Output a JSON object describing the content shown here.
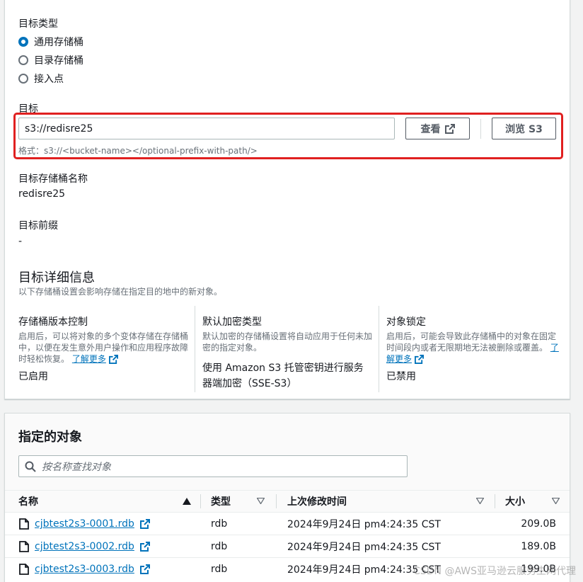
{
  "destination_type": {
    "heading": "目标类型",
    "options": [
      {
        "label": "通用存储桶",
        "selected": true
      },
      {
        "label": "目录存储桶",
        "selected": false
      },
      {
        "label": "接入点",
        "selected": false
      }
    ]
  },
  "destination": {
    "heading": "目标",
    "value": "s3://redisre25",
    "view_button": "查看",
    "browse_button": "浏览 S3",
    "format_hint": "格式：s3://<bucket-name></optional-prefix-with-path/>"
  },
  "bucket_name": {
    "label": "目标存储桶名称",
    "value": "redisre25"
  },
  "prefix": {
    "label": "目标前缀",
    "value": "-"
  },
  "details": {
    "title": "目标详细信息",
    "subtitle": "以下存储桶设置会影响存储在指定目的地中的新对象。",
    "versioning": {
      "title": "存储桶版本控制",
      "desc": "启用后，可以将对象的多个变体存储在存储桶中，以便在发生意外用户操作和应用程序故障时轻松恢复。",
      "link": "了解更多",
      "value": "已启用"
    },
    "encryption": {
      "title": "默认加密类型",
      "desc": "默认加密的存储桶设置将自动应用于任何未加密的指定对象。",
      "value": "使用 Amazon S3 托管密钥进行服务器端加密（SSE-S3）"
    },
    "object_lock": {
      "title": "对象锁定",
      "desc": "启用后，可能会导致此存储桶中的对象在固定时间段内或者无限期地无法被删除或覆盖。",
      "link": "了解更多",
      "value": "已禁用"
    }
  },
  "objects": {
    "title": "指定的对象",
    "search_placeholder": "按名称查找对象",
    "columns": [
      "名称",
      "类型",
      "上次修改时间",
      "大小"
    ],
    "rows": [
      {
        "name": "cjbtest2s3-0001.rdb",
        "type": "rdb",
        "modified": "2024年9月24日 pm4:24:35 CST",
        "size": "209.0B"
      },
      {
        "name": "cjbtest2s3-0002.rdb",
        "type": "rdb",
        "modified": "2024年9月24日 pm4:24:35 CST",
        "size": "189.0B"
      },
      {
        "name": "cjbtest2s3-0003.rdb",
        "type": "rdb",
        "modified": "2024年9月24日 pm4:24:35 CST",
        "size": "199.0B"
      }
    ]
  },
  "watermark": "CSDN @AWS亚马逊云服务生网代理",
  "colors": {
    "accent": "#0073bb",
    "highlight": "#e02020"
  }
}
